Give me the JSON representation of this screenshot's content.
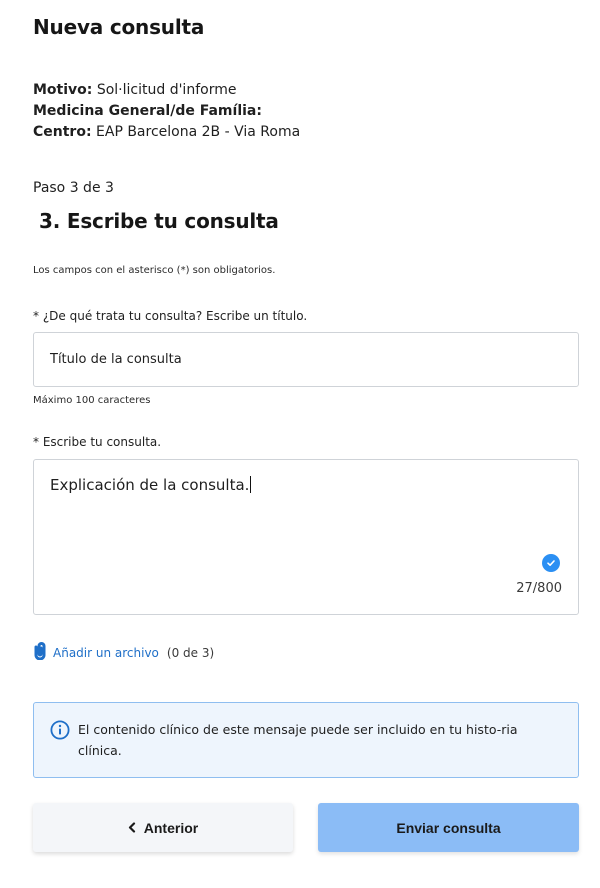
{
  "header": {
    "title": "Nueva consulta"
  },
  "meta": {
    "motivo_label": "Motivo:",
    "motivo_value": "Sol·licitud d'informe",
    "specialty": "Medicina General/de Família:",
    "centro_label": "Centro:",
    "centro_value": "EAP Barcelona 2B - Via Roma"
  },
  "step": {
    "indicator": "Paso 3 de 3",
    "title": "3. Escribe tu consulta"
  },
  "form": {
    "required_note": "Los campos con el asterisco (*) son obligatorios.",
    "title_field": {
      "label": "* ¿De qué trata tu consulta? Escribe un título.",
      "value": "Título de la consulta",
      "helper": "Máximo 100 caracteres"
    },
    "body_field": {
      "label": "* Escribe tu consulta.",
      "value": "Explicación de la consulta.",
      "counter": "27/800"
    },
    "attachment": {
      "link_label": "Añadir un archivo",
      "count": "(0 de 3)"
    }
  },
  "info": {
    "text": "El contenido clínico de este mensaje puede ser incluido en tu histo-ria clínica."
  },
  "buttons": {
    "prev_label": "Anterior",
    "send_label": "Enviar consulta"
  },
  "colors": {
    "accent": "#2b8ff3",
    "link": "#1f6fc8",
    "primary_button": "#8bbcf6",
    "info_bg": "#eef5fd",
    "info_border": "#8fbef0"
  },
  "icons": {
    "check": "check-circle-icon",
    "attach": "paperclip-icon",
    "info": "info-icon",
    "prev": "chevron-left-icon"
  }
}
